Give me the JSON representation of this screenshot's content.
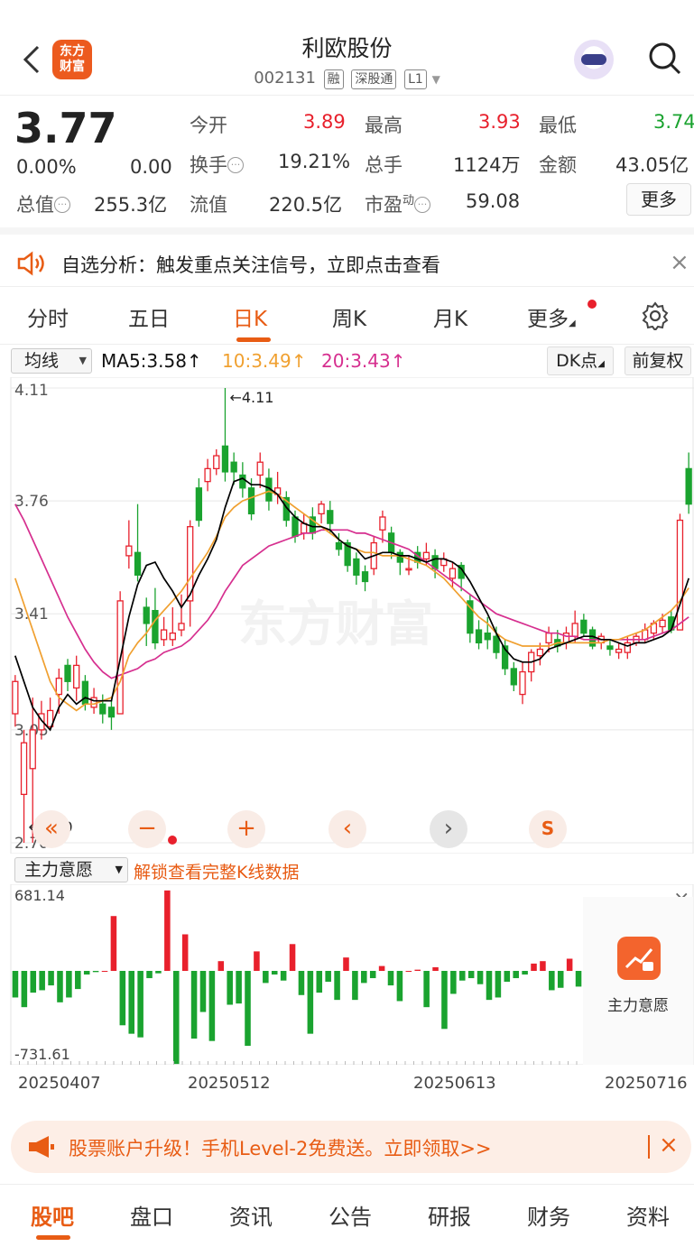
{
  "header": {
    "logo_text": "东方\n财富",
    "title": "利欧股份",
    "code": "002131",
    "tags": [
      "融",
      "深股通",
      "L1"
    ]
  },
  "quote": {
    "price": "3.77",
    "change_pct": "0.00%",
    "change": "0.00",
    "open_label": "今开",
    "open": "3.89",
    "high_label": "最高",
    "high": "3.93",
    "low_label": "最低",
    "low": "3.74",
    "turnover_label": "换手",
    "turnover": "19.21%",
    "volume_label": "总手",
    "volume": "1124万",
    "amount_label": "金额",
    "amount": "43.05亿",
    "mcap_label": "总值",
    "mcap": "255.3亿",
    "float_label": "流值",
    "float_cap": "220.5亿",
    "pe_label": "市盈",
    "pe_sup": "动",
    "pe": "59.08",
    "more": "更多"
  },
  "alert": {
    "text": "自选分析：触发重点关注信号，立即点击查看"
  },
  "kline_tabs": [
    "分时",
    "五日",
    "日K",
    "周K",
    "月K",
    "更多"
  ],
  "ma": {
    "selector": "均线",
    "ma5": "MA5:3.58↑",
    "ma10": "10:3.49↑",
    "ma20": "20:3.43↑",
    "dk": "DK点",
    "fq": "前复权"
  },
  "chart_data": {
    "type": "candlestick",
    "y_ticks": [
      "4.11",
      "3.76",
      "3.41",
      "3.05",
      "2.70"
    ],
    "ylim": [
      2.7,
      4.11
    ],
    "high_label": "←4.11",
    "low_label": "←2.70",
    "watermark": "东方财富",
    "candles": [
      [
        3.1,
        3.2,
        3.06,
        3.22
      ],
      [
        2.85,
        3.01,
        2.7,
        3.05
      ],
      [
        2.93,
        3.05,
        2.7,
        3.15
      ],
      [
        3.05,
        3.1,
        3.02,
        3.14
      ],
      [
        3.06,
        3.11,
        3.05,
        3.15
      ],
      [
        3.16,
        3.21,
        3.1,
        3.24
      ],
      [
        3.25,
        3.2,
        3.17,
        3.27
      ],
      [
        3.18,
        3.25,
        3.14,
        3.28
      ],
      [
        3.2,
        3.13,
        3.11,
        3.22
      ],
      [
        3.12,
        3.15,
        3.1,
        3.18
      ],
      [
        3.13,
        3.1,
        3.07,
        3.16
      ],
      [
        3.12,
        3.09,
        3.05,
        3.14
      ],
      [
        3.1,
        3.45,
        3.1,
        3.48
      ],
      [
        3.59,
        3.62,
        3.55,
        3.7
      ],
      [
        3.6,
        3.53,
        3.51,
        3.75
      ],
      [
        3.43,
        3.38,
        3.31,
        3.46
      ],
      [
        3.42,
        3.32,
        3.3,
        3.49
      ],
      [
        3.33,
        3.36,
        3.31,
        3.4
      ],
      [
        3.33,
        3.35,
        3.31,
        3.43
      ],
      [
        3.36,
        3.38,
        3.34,
        3.47
      ],
      [
        3.45,
        3.68,
        3.37,
        3.7
      ],
      [
        3.8,
        3.7,
        3.68,
        3.83
      ],
      [
        3.82,
        3.86,
        3.79,
        3.89
      ],
      [
        3.86,
        3.9,
        3.84,
        3.92
      ],
      [
        3.93,
        3.85,
        3.82,
        4.11
      ],
      [
        3.88,
        3.85,
        3.81,
        3.91
      ],
      [
        3.84,
        3.8,
        3.77,
        3.88
      ],
      [
        3.8,
        3.72,
        3.7,
        3.83
      ],
      [
        3.84,
        3.88,
        3.8,
        3.91
      ],
      [
        3.83,
        3.76,
        3.73,
        3.86
      ],
      [
        3.78,
        3.8,
        3.75,
        3.85
      ],
      [
        3.77,
        3.7,
        3.68,
        3.79
      ],
      [
        3.71,
        3.65,
        3.63,
        3.73
      ],
      [
        3.66,
        3.69,
        3.64,
        3.72
      ],
      [
        3.71,
        3.66,
        3.64,
        3.74
      ],
      [
        3.72,
        3.75,
        3.69,
        3.76
      ],
      [
        3.73,
        3.69,
        3.66,
        3.76
      ],
      [
        3.63,
        3.61,
        3.59,
        3.66
      ],
      [
        3.63,
        3.56,
        3.54,
        3.64
      ],
      [
        3.58,
        3.53,
        3.5,
        3.6
      ],
      [
        3.54,
        3.51,
        3.48,
        3.56
      ],
      [
        3.55,
        3.63,
        3.53,
        3.65
      ],
      [
        3.67,
        3.71,
        3.63,
        3.73
      ],
      [
        3.66,
        3.6,
        3.58,
        3.68
      ],
      [
        3.6,
        3.57,
        3.53,
        3.61
      ],
      [
        3.55,
        3.55,
        3.53,
        3.59
      ],
      [
        3.6,
        3.57,
        3.55,
        3.62
      ],
      [
        3.58,
        3.6,
        3.56,
        3.63
      ],
      [
        3.59,
        3.55,
        3.52,
        3.61
      ],
      [
        3.56,
        3.58,
        3.54,
        3.6
      ],
      [
        3.52,
        3.55,
        3.49,
        3.57
      ],
      [
        3.56,
        3.52,
        3.48,
        3.57
      ],
      [
        3.45,
        3.35,
        3.32,
        3.47
      ],
      [
        3.36,
        3.32,
        3.3,
        3.39
      ],
      [
        3.35,
        3.33,
        3.3,
        3.4
      ],
      [
        3.34,
        3.29,
        3.27,
        3.37
      ],
      [
        3.31,
        3.24,
        3.22,
        3.33
      ],
      [
        3.24,
        3.19,
        3.17,
        3.26
      ],
      [
        3.16,
        3.23,
        3.13,
        3.26
      ],
      [
        3.23,
        3.29,
        3.2,
        3.3
      ],
      [
        3.28,
        3.3,
        3.25,
        3.32
      ],
      [
        3.32,
        3.35,
        3.29,
        3.37
      ],
      [
        3.33,
        3.31,
        3.29,
        3.36
      ],
      [
        3.32,
        3.35,
        3.3,
        3.37
      ],
      [
        3.34,
        3.38,
        3.32,
        3.42
      ],
      [
        3.39,
        3.35,
        3.34,
        3.41
      ],
      [
        3.36,
        3.31,
        3.3,
        3.37
      ],
      [
        3.32,
        3.34,
        3.3,
        3.35
      ],
      [
        3.31,
        3.3,
        3.28,
        3.33
      ],
      [
        3.29,
        3.3,
        3.27,
        3.32
      ],
      [
        3.29,
        3.32,
        3.27,
        3.34
      ],
      [
        3.32,
        3.34,
        3.31,
        3.35
      ],
      [
        3.33,
        3.36,
        3.32,
        3.38
      ],
      [
        3.35,
        3.38,
        3.33,
        3.39
      ],
      [
        3.37,
        3.39,
        3.35,
        3.41
      ],
      [
        3.4,
        3.36,
        3.35,
        3.42
      ],
      [
        3.36,
        3.7,
        3.36,
        3.72
      ],
      [
        3.86,
        3.75,
        3.72,
        3.91
      ]
    ],
    "ma5": [
      3.28,
      3.2,
      3.12,
      3.08,
      3.05,
      3.12,
      3.16,
      3.13,
      3.15,
      3.14,
      3.14,
      3.14,
      3.27,
      3.4,
      3.5,
      3.56,
      3.57,
      3.52,
      3.48,
      3.43,
      3.47,
      3.53,
      3.58,
      3.64,
      3.74,
      3.82,
      3.83,
      3.81,
      3.81,
      3.8,
      3.78,
      3.74,
      3.71,
      3.69,
      3.68,
      3.68,
      3.67,
      3.64,
      3.62,
      3.61,
      3.58,
      3.59,
      3.6,
      3.6,
      3.59,
      3.59,
      3.58,
      3.57,
      3.58,
      3.58,
      3.57,
      3.55,
      3.51,
      3.46,
      3.41,
      3.35,
      3.3,
      3.27,
      3.26,
      3.26,
      3.27,
      3.3,
      3.31,
      3.32,
      3.33,
      3.34,
      3.34,
      3.33,
      3.33,
      3.32,
      3.31,
      3.32,
      3.32,
      3.33,
      3.34,
      3.36,
      3.44,
      3.52
    ],
    "ma10": [
      3.52,
      3.44,
      3.36,
      3.28,
      3.2,
      3.15,
      3.13,
      3.11,
      3.13,
      3.13,
      3.14,
      3.15,
      3.2,
      3.28,
      3.32,
      3.35,
      3.39,
      3.42,
      3.45,
      3.48,
      3.52,
      3.56,
      3.6,
      3.65,
      3.71,
      3.74,
      3.76,
      3.77,
      3.78,
      3.79,
      3.78,
      3.76,
      3.74,
      3.72,
      3.7,
      3.68,
      3.66,
      3.64,
      3.62,
      3.61,
      3.6,
      3.6,
      3.59,
      3.59,
      3.59,
      3.58,
      3.57,
      3.56,
      3.54,
      3.52,
      3.49,
      3.46,
      3.43,
      3.4,
      3.38,
      3.35,
      3.33,
      3.32,
      3.31,
      3.31,
      3.31,
      3.31,
      3.32,
      3.32,
      3.32,
      3.32,
      3.32,
      3.32,
      3.33,
      3.33,
      3.34,
      3.35,
      3.36,
      3.38,
      3.4,
      3.42,
      3.45,
      3.49
    ],
    "ma20": [
      3.75,
      3.7,
      3.64,
      3.58,
      3.52,
      3.46,
      3.4,
      3.35,
      3.3,
      3.26,
      3.23,
      3.21,
      3.22,
      3.23,
      3.24,
      3.26,
      3.27,
      3.29,
      3.3,
      3.31,
      3.33,
      3.36,
      3.39,
      3.43,
      3.48,
      3.52,
      3.56,
      3.58,
      3.6,
      3.62,
      3.63,
      3.64,
      3.65,
      3.66,
      3.66,
      3.67,
      3.67,
      3.67,
      3.67,
      3.66,
      3.66,
      3.65,
      3.64,
      3.63,
      3.62,
      3.61,
      3.59,
      3.57,
      3.55,
      3.53,
      3.51,
      3.49,
      3.47,
      3.45,
      3.43,
      3.41,
      3.4,
      3.39,
      3.38,
      3.37,
      3.36,
      3.35,
      3.35,
      3.34,
      3.34,
      3.33,
      3.33,
      3.33,
      3.33,
      3.33,
      3.33,
      3.33,
      3.33,
      3.34,
      3.35,
      3.36,
      3.38,
      3.4
    ]
  },
  "volume_panel": {
    "selector": "主力意愿",
    "unlock_text": "解锁查看完整K线数据",
    "max_label": "681.14",
    "min_label": "-731.61",
    "side_label": "主力意愿",
    "values": [
      -220,
      -300,
      -180,
      -160,
      -120,
      -260,
      -220,
      -150,
      -30,
      -10,
      0,
      450,
      -450,
      -520,
      -550,
      -60,
      -20,
      660,
      -770,
      300,
      -560,
      -340,
      -580,
      80,
      -280,
      -270,
      -620,
      160,
      -100,
      -30,
      -80,
      220,
      -200,
      -520,
      -180,
      -90,
      -240,
      110,
      -240,
      -100,
      -60,
      40,
      -120,
      -250,
      0,
      10,
      -300,
      30,
      -480,
      -190,
      -80,
      -60,
      -110,
      -240,
      -220,
      -90,
      -60,
      -30,
      60,
      80,
      -160,
      -140,
      100,
      -130
    ]
  },
  "x_labels": [
    "20250407",
    "20250512",
    "20250613",
    "20250716"
  ],
  "promo": {
    "text": "股票账户升级！手机Level-2免费送。立即领取>>"
  },
  "bottom_tabs": [
    "股吧",
    "盘口",
    "资讯",
    "公告",
    "研报",
    "财务",
    "资料"
  ],
  "colors": {
    "accent": "#e85c14",
    "up": "#e8202c",
    "down": "#1aa32f",
    "ma5": "#000000",
    "ma10": "#f0a030",
    "ma20": "#d62f8f"
  }
}
